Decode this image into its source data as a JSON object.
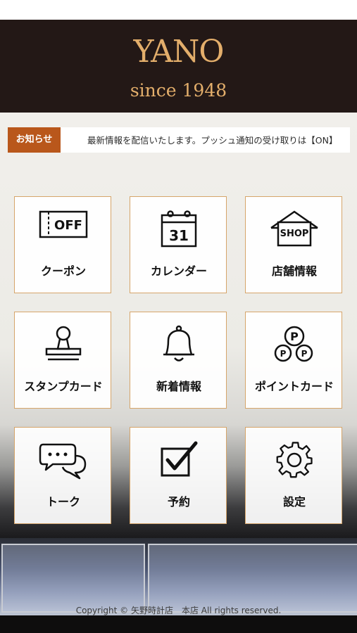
{
  "header": {
    "logo": "YANO",
    "since": "since 1948"
  },
  "news": {
    "tag": "お知らせ",
    "text": "最新情報を配信いたします。プッシュ通知の受け取りは【ON】"
  },
  "menu": {
    "coupon": {
      "label": "クーポン",
      "icon_text": "OFF"
    },
    "calendar": {
      "label": "カレンダー",
      "icon_text": "31"
    },
    "shop": {
      "label": "店舗情報",
      "icon_text": "SHOP"
    },
    "stamp": {
      "label": "スタンプカード"
    },
    "news": {
      "label": "新着情報"
    },
    "point": {
      "label": "ポイントカード",
      "icon_text": "P"
    },
    "talk": {
      "label": "トーク"
    },
    "reserve": {
      "label": "予約"
    },
    "settings": {
      "label": "設定"
    }
  },
  "footer": {
    "copyright": "Copyright © 矢野時計店　本店 All rights reserved."
  }
}
